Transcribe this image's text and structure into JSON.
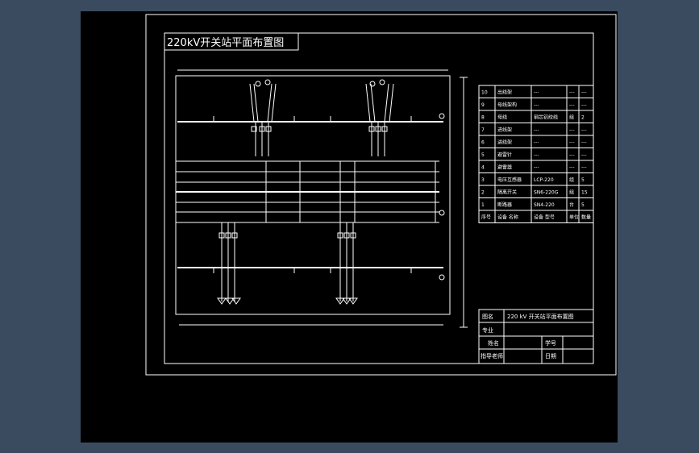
{
  "drawing": {
    "title": "220kV开关站平面布置图"
  },
  "equipment_table": {
    "header": {
      "no": "序号",
      "name": "设备 名称",
      "model": "设备 型号",
      "unit": "单位",
      "qty": "数量"
    },
    "rows": [
      {
        "no": "10",
        "name": "出线架",
        "model": "---",
        "unit": "---",
        "qty": "---"
      },
      {
        "no": "9",
        "name": "母线架构",
        "model": "---",
        "unit": "---",
        "qty": "---"
      },
      {
        "no": "8",
        "name": "母线",
        "model": "钢芯铝绞线",
        "unit": "组",
        "qty": "2"
      },
      {
        "no": "7",
        "name": "进线架",
        "model": "---",
        "unit": "---",
        "qty": "---"
      },
      {
        "no": "6",
        "name": "进线架",
        "model": "---",
        "unit": "---",
        "qty": "---"
      },
      {
        "no": "5",
        "name": "避雷针",
        "model": "---",
        "unit": "---",
        "qty": "---"
      },
      {
        "no": "4",
        "name": "避雷器",
        "model": "---",
        "unit": "---",
        "qty": "---"
      },
      {
        "no": "3",
        "name": "电压互感器",
        "model": "LCP-220",
        "unit": "组",
        "qty": "5"
      },
      {
        "no": "2",
        "name": "隔离开关",
        "model": "SN6-220G",
        "unit": "组",
        "qty": "15"
      },
      {
        "no": "1",
        "name": "断路器",
        "model": "SN4-220",
        "unit": "台",
        "qty": "5"
      }
    ]
  },
  "title_block": {
    "drawing_name_label": "图名",
    "drawing_name": "220 kV 开关站平面布置图",
    "major_label": "专业",
    "name_label": "姓名",
    "student_no_label": "学号",
    "advisor_label": "指导老师",
    "date_label": "日期"
  }
}
